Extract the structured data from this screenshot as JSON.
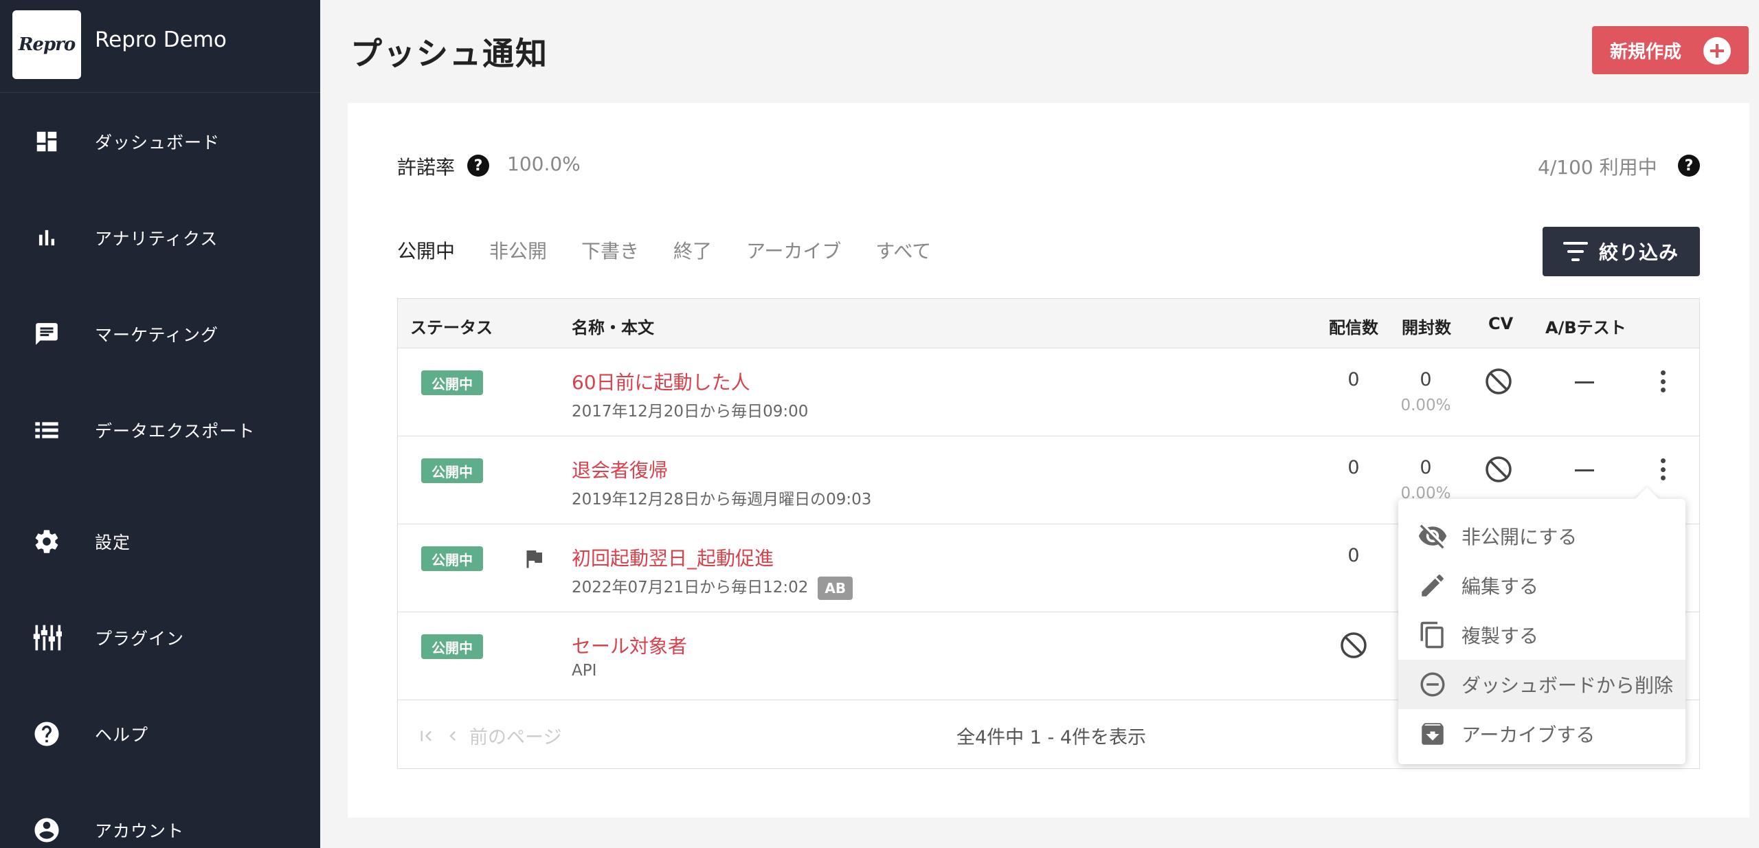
{
  "app": {
    "logo_text": "Repro",
    "name": "Repro Demo"
  },
  "sidebar": {
    "items": [
      {
        "label": "ダッシュボード",
        "icon": "dashboard-icon"
      },
      {
        "label": "アナリティクス",
        "icon": "bar-chart-icon"
      },
      {
        "label": "マーケティング",
        "icon": "chat-icon"
      },
      {
        "label": "データエクスポート",
        "icon": "list-icon"
      },
      {
        "label": "設定",
        "icon": "gear-icon"
      },
      {
        "label": "プラグイン",
        "icon": "sliders-icon"
      },
      {
        "label": "ヘルプ",
        "icon": "help-icon"
      },
      {
        "label": "アカウント",
        "icon": "account-icon"
      }
    ]
  },
  "header": {
    "title": "プッシュ通知",
    "new_button_label": "新規作成"
  },
  "summary": {
    "rate_label": "許諾率",
    "rate_value": "100.0%",
    "usage_text": "4/100 利用中"
  },
  "tabs": [
    "公開中",
    "非公開",
    "下書き",
    "終了",
    "アーカイブ",
    "すべて"
  ],
  "filter_label": "絞り込み",
  "table": {
    "headers": {
      "status": "ステータス",
      "name": "名称・本文",
      "sent": "配信数",
      "opened": "開封数",
      "cv": "CV",
      "ab": "A/Bテスト"
    },
    "rows": [
      {
        "status": "公開中",
        "name": "60日前に起動した人",
        "sub": "2017年12月20日から毎日09:00",
        "sent": "0",
        "opened": "0",
        "open_rate": "0.00%"
      },
      {
        "status": "公開中",
        "name": "退会者復帰",
        "sub": "2019年12月28日から毎週月曜日の09:03",
        "sent": "0",
        "opened": "0",
        "open_rate": "0.00%"
      },
      {
        "status": "公開中",
        "name": "初回起動翌日_起動促進",
        "sub": "2022年07月21日から毎日12:02",
        "ab_badge": "AB",
        "sent": "0"
      },
      {
        "status": "公開中",
        "name": "セール対象者",
        "sub": "API"
      }
    ]
  },
  "pager": {
    "prev_label": "前のページ",
    "info": "全4件中 1 - 4件を表示"
  },
  "context_menu": {
    "items": [
      {
        "label": "非公開にする",
        "icon": "eye-off-icon"
      },
      {
        "label": "編集する",
        "icon": "pencil-icon"
      },
      {
        "label": "複製する",
        "icon": "copy-icon"
      },
      {
        "label": "ダッシュボードから削除",
        "icon": "remove-circle-icon"
      },
      {
        "label": "アーカイブする",
        "icon": "archive-icon"
      }
    ]
  },
  "colors": {
    "sidebar_bg": "#1f2633",
    "accent_red": "#e0565f",
    "status_green": "#5fae8a",
    "filter_btn_bg": "#2d3240"
  }
}
